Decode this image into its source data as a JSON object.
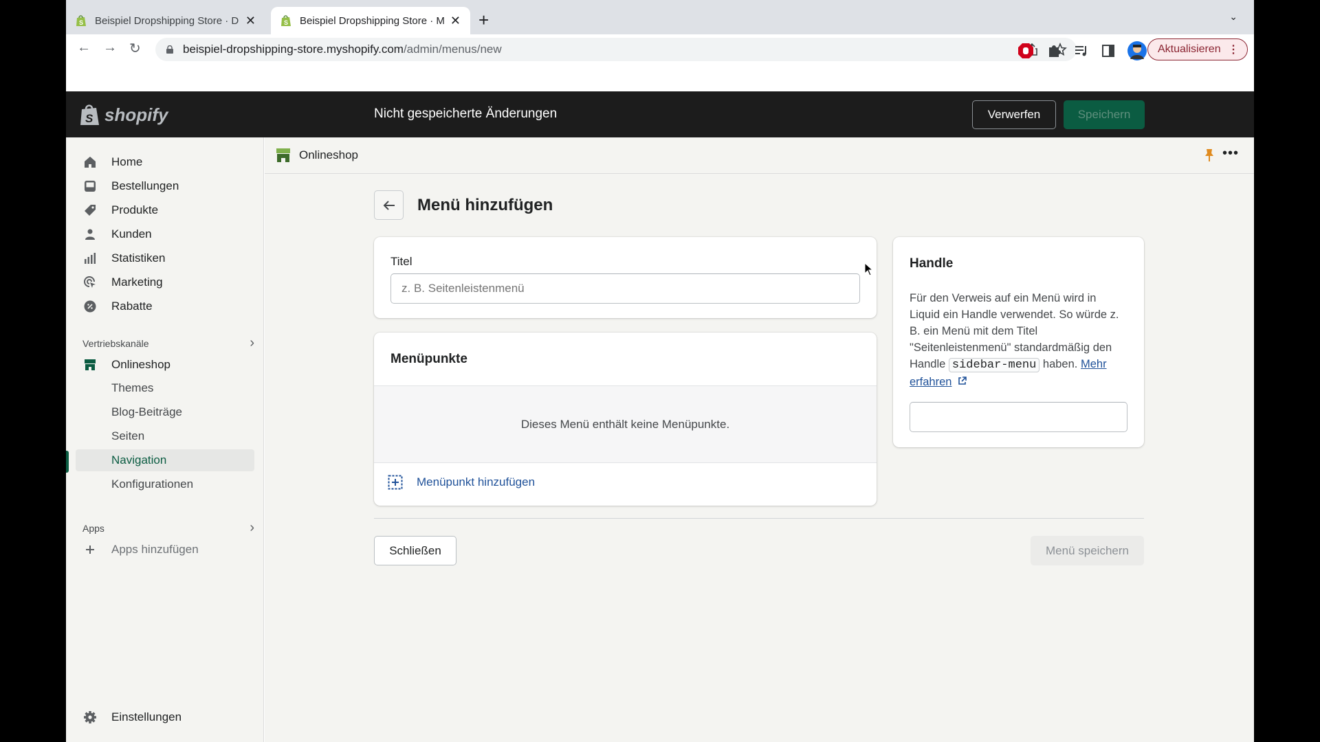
{
  "browser": {
    "tabs": [
      {
        "title": "Beispiel Dropshipping Store · D",
        "active": false
      },
      {
        "title": "Beispiel Dropshipping Store · M",
        "active": true
      }
    ],
    "new_tab_icon": "plus-icon",
    "url_host": "beispiel-dropshipping-store.myshopify.com",
    "url_path": "/admin/menus/new",
    "update_button": "Aktualisieren"
  },
  "topbar": {
    "logo_text": "shopify",
    "status": "Nicht gespeicherte Änderungen",
    "discard_label": "Verwerfen",
    "save_label": "Speichern"
  },
  "sidebar": {
    "items": [
      {
        "label": "Home",
        "icon": "home-icon"
      },
      {
        "label": "Bestellungen",
        "icon": "inbox-icon"
      },
      {
        "label": "Produkte",
        "icon": "tag-icon"
      },
      {
        "label": "Kunden",
        "icon": "person-icon"
      },
      {
        "label": "Statistiken",
        "icon": "bar-chart-icon"
      },
      {
        "label": "Marketing",
        "icon": "target-icon"
      },
      {
        "label": "Rabatte",
        "icon": "discount-icon"
      }
    ],
    "sales_channels_label": "Vertriebskanäle",
    "onlineshop_label": "Onlineshop",
    "onlineshop_sub": [
      "Themes",
      "Blog-Beiträge",
      "Seiten",
      "Navigation",
      "Konfigurationen"
    ],
    "active_sub": "Navigation",
    "apps_label": "Apps",
    "add_apps_label": "Apps hinzufügen",
    "settings_label": "Einstellungen"
  },
  "main": {
    "channel_name": "Onlineshop",
    "page_title": "Menü hinzufügen",
    "title_card": {
      "label": "Titel",
      "value": "",
      "placeholder": "z. B. Seitenleistenmenü"
    },
    "items_card": {
      "heading": "Menüpunkte",
      "empty_text": "Dieses Menü enthält keine Menüpunkte.",
      "add_label": "Menüpunkt hinzufügen"
    },
    "handle_card": {
      "heading": "Handle",
      "desc_1": "Für den Verweis auf ein Menü wird in Liquid ein Handle verwendet. So würde z. B. ein Menü mit dem Titel \"Seitenleistenmenü\" standardmäßig den Handle",
      "code": "sidebar-menu",
      "desc_2": "haben.",
      "link": "Mehr erfahren",
      "value": ""
    },
    "close_label": "Schließen",
    "save_menu_label": "Menü speichern"
  },
  "colors": {
    "brand_green": "#0b5c42",
    "topbar_bg": "#1c1c1c",
    "link_blue": "#1f5199",
    "pin_orange": "#e08b1f"
  }
}
